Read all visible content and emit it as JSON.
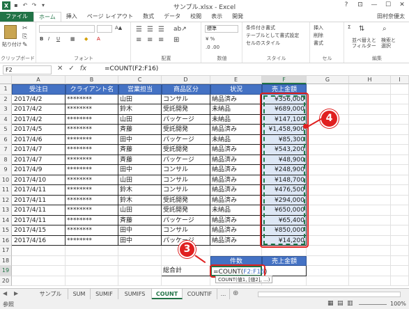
{
  "window": {
    "title": "サンプル.xlsx - Excel",
    "user": "田村奈優太",
    "controls": [
      "?",
      "⊡",
      "—",
      "☐",
      "✕"
    ]
  },
  "ribbon": {
    "tabs": [
      "ファイル",
      "ホーム",
      "挿入",
      "ページ レイアウト",
      "数式",
      "データ",
      "校閲",
      "表示",
      "開発"
    ],
    "groups": [
      "クリップボード",
      "フォント",
      "配置",
      "数値",
      "スタイル",
      "セル",
      "編集"
    ],
    "paste": "貼り付け",
    "number_format": "標準",
    "conditional": "条件付き書式",
    "table_format": "テーブルとして書式設定",
    "cell_style": "セルのスタイル",
    "insert": "挿入",
    "delete": "削除",
    "format": "書式",
    "sort": "並べ替えと\nフィルター",
    "find": "検索と\n選択"
  },
  "formula_bar": {
    "name_box": "F2",
    "formula": "=COUNT(F2:F16)"
  },
  "columns": [
    "A",
    "B",
    "C",
    "D",
    "E",
    "F",
    "G",
    "H",
    "I"
  ],
  "rows": [
    "1",
    "2",
    "3",
    "4",
    "5",
    "6",
    "7",
    "8",
    "9",
    "10",
    "11",
    "12",
    "13",
    "14",
    "15",
    "16",
    "17",
    "18",
    "19",
    "20"
  ],
  "table": {
    "headers": [
      "受注日",
      "クライアント名",
      "営業担当",
      "商品区分",
      "状況",
      "売上金額"
    ],
    "data": [
      [
        "2017/4/2",
        "********",
        "山田",
        "コンサル",
        "納品済み",
        "¥356,000"
      ],
      [
        "2017/4/2",
        "********",
        "鈴木",
        "受託開発",
        "未納品",
        "¥689,000"
      ],
      [
        "2017/4/2",
        "********",
        "山田",
        "パッケージ",
        "未納品",
        "¥147,100"
      ],
      [
        "2017/4/5",
        "********",
        "斉藤",
        "受託開発",
        "納品済み",
        "¥1,458,900"
      ],
      [
        "2017/4/6",
        "********",
        "田中",
        "パッケージ",
        "未納品",
        "¥85,300"
      ],
      [
        "2017/4/7",
        "********",
        "斉藤",
        "受託開発",
        "納品済み",
        "¥543,200"
      ],
      [
        "2017/4/7",
        "********",
        "斉藤",
        "パッケージ",
        "納品済み",
        "¥48,900"
      ],
      [
        "2017/4/9",
        "********",
        "田中",
        "コンサル",
        "納品済み",
        "¥248,900"
      ],
      [
        "2017/4/10",
        "********",
        "山田",
        "コンサル",
        "納品済み",
        "¥148,700"
      ],
      [
        "2017/4/11",
        "********",
        "鈴木",
        "コンサル",
        "納品済み",
        "¥476,500"
      ],
      [
        "2017/4/11",
        "********",
        "鈴木",
        "受託開発",
        "納品済み",
        "¥294,000"
      ],
      [
        "2017/4/11",
        "********",
        "山田",
        "受託開発",
        "未納品",
        "¥650,000"
      ],
      [
        "2017/4/11",
        "********",
        "斉藤",
        "パッケージ",
        "納品済み",
        "¥65,400"
      ],
      [
        "2017/4/15",
        "********",
        "田中",
        "コンサル",
        "納品済み",
        "¥850,000"
      ],
      [
        "2017/4/16",
        "********",
        "田中",
        "パッケージ",
        "納品済み",
        "¥14,200"
      ]
    ]
  },
  "summary": {
    "count_header": "件数",
    "sales_header": "売上金額",
    "row_label": "総合計",
    "formula_prefix": "=COUNT(",
    "formula_ref": "F2:F16",
    "formula_suffix": ")",
    "tooltip": "COUNT(値1, [値2], ...)"
  },
  "callouts": {
    "step3": "3",
    "step4": "4"
  },
  "sheet_tabs": [
    "サンプル",
    "SUM",
    "SUMIF",
    "SUMIFS",
    "COUNT",
    "COUNTIF",
    "..."
  ],
  "active_sheet": "COUNT",
  "status": {
    "mode": "参照",
    "zoom": "100%"
  },
  "colors": {
    "header_blue": "#4472c4",
    "excel_green": "#217346",
    "callout_red": "#e02020"
  }
}
